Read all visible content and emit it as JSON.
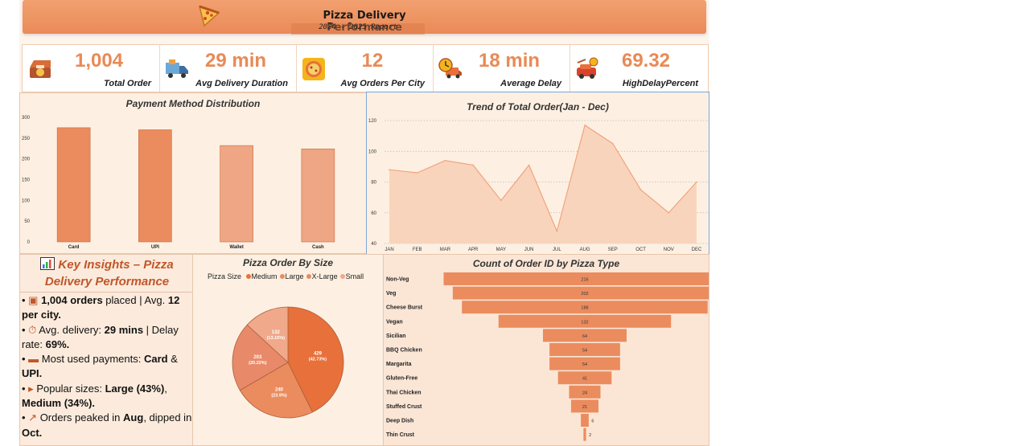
{
  "header": {
    "title": "Pizza Delivery Performance",
    "subtitle": "2024 - 2025 Report",
    "logo_icon": "pizza-slice-icon"
  },
  "kpis": [
    {
      "value": "1,004",
      "label": "Total Order",
      "icon": "pizza-box-icon"
    },
    {
      "value": "29 min",
      "label": "Avg Delivery Duration",
      "icon": "delivery-truck-icon"
    },
    {
      "value": "12",
      "label": "Avg Orders Per City",
      "icon": "pizza-badge-icon"
    },
    {
      "value": "18 min",
      "label": "Average Delay",
      "icon": "clock-truck-icon"
    },
    {
      "value": "69.32",
      "label": "HighDelayPercent",
      "icon": "delay-car-icon"
    }
  ],
  "insights": {
    "title": "Key Insights – Pizza Delivery Performance",
    "title_icon": "chart-icon",
    "items": [
      {
        "icon": "box-icon",
        "segments": [
          {
            "t": "1,004 orders",
            "b": true
          },
          {
            "t": " placed | Avg. ",
            "b": false
          },
          {
            "t": "12 per city.",
            "b": true
          }
        ]
      },
      {
        "icon": "stopwatch-icon",
        "segments": [
          {
            "t": "Avg. delivery: ",
            "b": false
          },
          {
            "t": "29 mins",
            "b": true
          },
          {
            "t": " | Delay rate: ",
            "b": false
          },
          {
            "t": "69%.",
            "b": true
          }
        ]
      },
      {
        "icon": "credit-card-icon",
        "segments": [
          {
            "t": "Most used payments: ",
            "b": false
          },
          {
            "t": "Card",
            "b": true
          },
          {
            "t": " & ",
            "b": false
          },
          {
            "t": "UPI.",
            "b": true
          }
        ]
      },
      {
        "icon": "pizza-icon",
        "segments": [
          {
            "t": "Popular sizes: ",
            "b": false
          },
          {
            "t": "Large (43%)",
            "b": true
          },
          {
            "t": ", ",
            "b": false
          },
          {
            "t": "Medium (34%).",
            "b": true
          }
        ]
      },
      {
        "icon": "trend-chart-icon",
        "segments": [
          {
            "t": "Orders peaked in ",
            "b": false
          },
          {
            "t": "Aug",
            "b": true
          },
          {
            "t": ", dipped in ",
            "b": false
          },
          {
            "t": "Oct.",
            "b": true
          }
        ]
      }
    ]
  },
  "chart_data": [
    {
      "type": "bar",
      "title": "Payment Method Distribution",
      "categories": [
        "Card",
        "UPI",
        "Wallet",
        "Cash"
      ],
      "values": [
        275,
        270,
        232,
        224
      ],
      "colors": [
        "#eb8c5e",
        "#eb8c5e",
        "#eea684",
        "#eea684"
      ],
      "ylim": [
        0,
        300
      ],
      "yticks": [
        0,
        50,
        100,
        150,
        200,
        250,
        300
      ]
    },
    {
      "type": "area",
      "title": "Trend of Total Order(Jan - Dec)",
      "categories": [
        "JAN",
        "FEB",
        "MAR",
        "APR",
        "MAY",
        "JUN",
        "JUL",
        "AUG",
        "SEP",
        "OCT",
        "NOV",
        "DEC"
      ],
      "values": [
        88,
        86,
        94,
        91,
        68,
        91,
        48,
        117,
        105,
        75,
        60,
        80
      ],
      "ylim": [
        40,
        120
      ],
      "yticks": [
        40,
        60,
        80,
        100,
        120
      ],
      "grid": true,
      "color": "#f4b595"
    },
    {
      "type": "pie",
      "title": "Pizza Order By Size",
      "legend_title": "Pizza Size",
      "legend": [
        {
          "name": "Medium",
          "color": "#e8703b"
        },
        {
          "name": "Large",
          "color": "#eb8c5e"
        },
        {
          "name": "X-Large",
          "color": "#e88a6a"
        },
        {
          "name": "Small",
          "color": "#f0a98a"
        }
      ],
      "slices": [
        {
          "name": "Medium",
          "value": 429,
          "label": "429",
          "pct": "(42.73%)",
          "color": "#e8703b"
        },
        {
          "name": "Large",
          "value": 240,
          "label": "240",
          "pct": "(23.9%)",
          "color": "#eb8c5e"
        },
        {
          "name": "X-Large",
          "value": 203,
          "label": "203",
          "pct": "(20.22%)",
          "color": "#e88a6a"
        },
        {
          "name": "Small",
          "value": 132,
          "label": "132",
          "pct": "(13.15%)",
          "color": "#f0a98a"
        }
      ]
    },
    {
      "type": "bar",
      "title": "Count of Order ID by Pizza Type",
      "categories": [
        "Non-Veg",
        "Veg",
        "Cheese Burst",
        "Vegan",
        "Sicilian",
        "BBQ Chicken",
        "Margarita",
        "Gluten-Free",
        "Thai Chicken",
        "Stuffed Crust",
        "Deep Dish",
        "Thin Crust"
      ],
      "values": [
        216,
        202,
        188,
        132,
        64,
        54,
        54,
        41,
        24,
        21,
        6,
        2
      ],
      "color": "#eb8c5e"
    }
  ]
}
